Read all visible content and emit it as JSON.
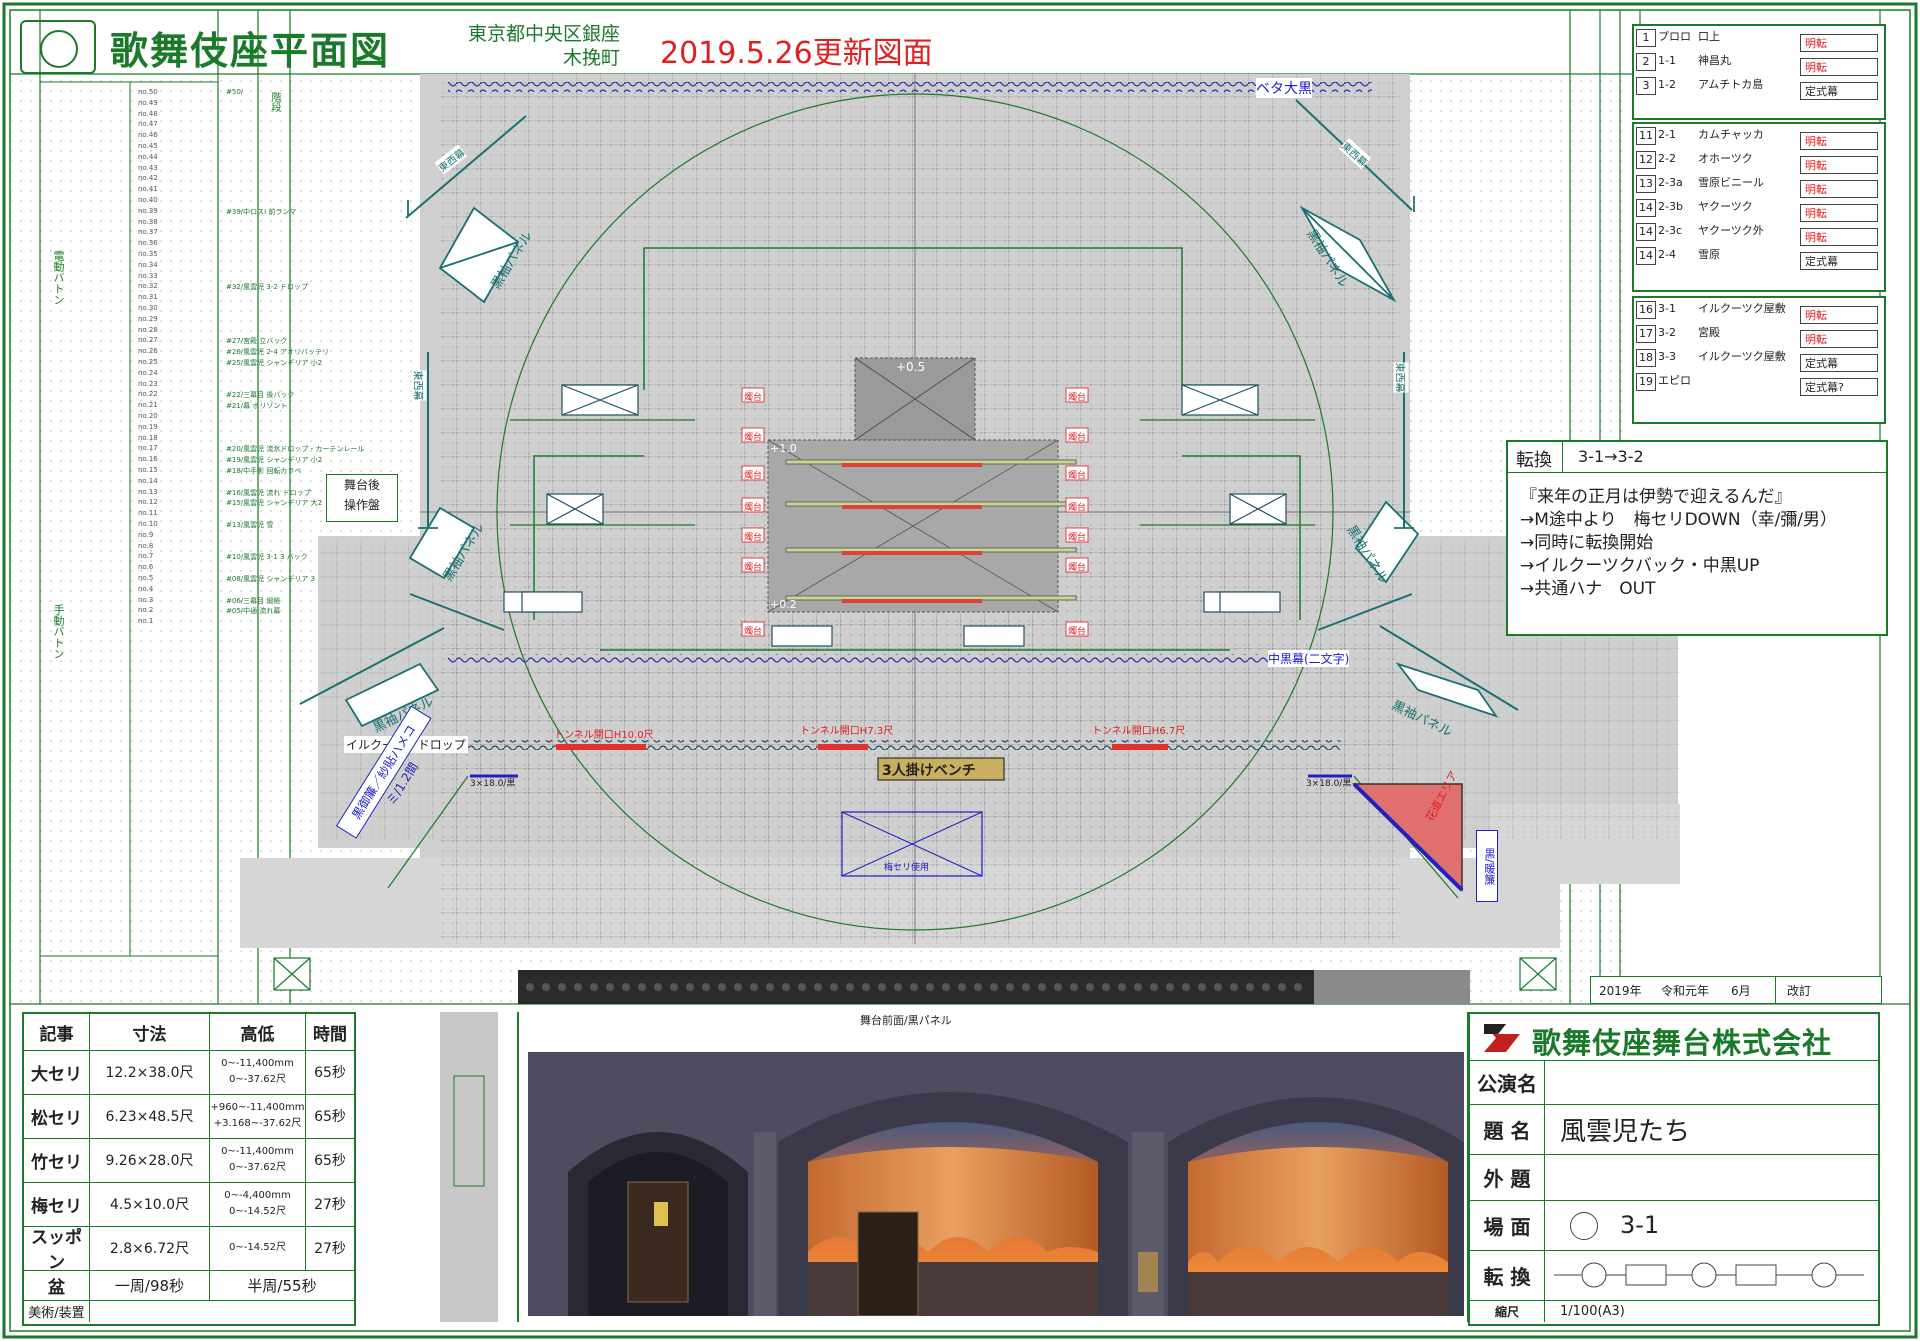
{
  "header": {
    "title": "歌舞伎座平面図",
    "address_line1": "東京都中央区銀座",
    "address_line2": "木挽町",
    "date_note": "2019.5.26更新図面"
  },
  "scenes_group1": [
    {
      "no": "1",
      "scene": "プロロ",
      "title": "口上",
      "change": "明転"
    },
    {
      "no": "2",
      "scene": "1-1",
      "title": "神昌丸",
      "change": "明転"
    },
    {
      "no": "3",
      "scene": "1-2",
      "title": "アムチトカ島",
      "change": "定式幕"
    }
  ],
  "scenes_group2": [
    {
      "no": "11",
      "scene": "2-1",
      "title": "カムチャッカ",
      "change": "明転"
    },
    {
      "no": "12",
      "scene": "2-2",
      "title": "オホーツク",
      "change": "明転"
    },
    {
      "no": "13",
      "scene": "2-3a",
      "title": "雪原ビニール",
      "change": "明転"
    },
    {
      "no": "14",
      "scene": "2-3b",
      "title": "ヤクーツク",
      "change": "明転"
    },
    {
      "no": "14",
      "scene": "2-3c",
      "title": "ヤクーツク外",
      "change": "明転"
    },
    {
      "no": "14",
      "scene": "2-4",
      "title": "雪原",
      "change": "定式幕"
    }
  ],
  "scenes_group3": [
    {
      "no": "16",
      "scene": "3-1",
      "title": "イルクーツク屋敷",
      "change": "明転"
    },
    {
      "no": "17",
      "scene": "3-2",
      "title": "宮殿",
      "change": "明転"
    },
    {
      "no": "18",
      "scene": "3-3",
      "title": "イルクーツク屋敷",
      "change": "定式幕"
    },
    {
      "no": "19",
      "scene": "エピロ",
      "title": "",
      "change": "定式幕?"
    }
  ],
  "transition": {
    "label": "転換",
    "value": "3-1→3-2",
    "lines": [
      "『来年の正月は伊勢で迎えるんだ』",
      "→M途中より　梅セリDOWN（幸/彌/男）",
      "→同時に転換開始",
      "→イルクーツクバック・中黒UP",
      "→共通ハナ　OUT"
    ]
  },
  "stage_labels": {
    "beta_kuro": "ベタ大黒",
    "naka_kuro": "中黒幕(二文字)",
    "irkutsk_drop": "イルクーツクドロップ",
    "bench": "3人掛けベンチ",
    "ume_seri": "梅セリ使用",
    "tunnel1": "トンネル開口H10.0尺",
    "tunnel2": "トンネル開口H7.3尺",
    "tunnel3": "トンネル開口H6.7尺",
    "kurosode_panel": "黒袖パネル",
    "touzai_maku": "東西幕",
    "candle": "燭台",
    "butai_ura": "舞台後",
    "sousa_ban": "操作盤",
    "plus05": "+0.5",
    "plus10": "+1.0",
    "plus02": "+0.2",
    "left_sign": "黒御簾／紗貼ハメコミ/1.2間",
    "right_sign": "花道エリア",
    "right_vert": "黒/暖簾",
    "left_3x18": "3×18.0/黒",
    "right_3x18": "3×18.0/黒",
    "electric_batten": "電動バトン",
    "manual_batten": "手動バトン",
    "kaidan": "階段",
    "front_label": "舞台前面/黒パネル"
  },
  "revision": {
    "year": "2019年",
    "era": "令和元年",
    "month": "6月",
    "label": "改訂"
  },
  "seri_table": {
    "headers": [
      "記事",
      "寸法",
      "高低",
      "時間"
    ],
    "rows": [
      {
        "name": "大セリ",
        "size": "12.2×38.0尺",
        "range1": "0~-11,400mm",
        "range2": "0~-37.62尺",
        "time": "65秒"
      },
      {
        "name": "松セリ",
        "size": "6.23×48.5尺",
        "range1": "+960~-11,400mm",
        "range2": "+3.168~-37.62尺",
        "time": "65秒"
      },
      {
        "name": "竹セリ",
        "size": "9.26×28.0尺",
        "range1": "0~-11,400mm",
        "range2": "0~-37.62尺",
        "time": "65秒"
      },
      {
        "name": "梅セリ",
        "size": "4.5×10.0尺",
        "range1": "0~-4,400mm",
        "range2": "0~-14.52尺",
        "time": "27秒"
      },
      {
        "name": "スッポン",
        "size": "2.8×6.72尺",
        "range1": "0~-14.52尺",
        "range2": "",
        "time": "27秒"
      }
    ],
    "bon_label": "盆",
    "bon_full": "一周/98秒",
    "bon_half": "半周/55秒",
    "art_label": "美術/装置"
  },
  "title_block": {
    "company": "歌舞伎座舞台株式会社",
    "performance_label": "公演名",
    "performance_value": "",
    "title_label": "題 名",
    "title_value": "風雲児たち",
    "subtitle_label": "外 題",
    "subtitle_value": "",
    "scene_label": "場 面",
    "scene_value": "3-1",
    "change_label": "転 換",
    "scale_label": "縮尺",
    "scale_value": "1/100(A3)"
  },
  "battens": [
    "no.50",
    "no.49",
    "no.48",
    "no.47",
    "no.46",
    "no.45",
    "no.44",
    "no.43",
    "no.42",
    "no.41",
    "no.40",
    "no.39",
    "no.38",
    "no.37",
    "no.36",
    "no.35",
    "no.34",
    "no.33",
    "no.32",
    "no.31",
    "no.30",
    "no.29",
    "no.28",
    "no.27",
    "no.26",
    "no.25",
    "no.24",
    "no.23",
    "no.22",
    "no.21",
    "no.20",
    "no.19",
    "no.18",
    "no.17",
    "no.16",
    "no.15",
    "no.14",
    "no.13",
    "no.12",
    "no.11",
    "no.10",
    "no.9",
    "no.8",
    "no.7",
    "no.6",
    "no.5",
    "no.4",
    "no.3",
    "no.2",
    "no.1"
  ],
  "batten_named": [
    {
      "row": 1,
      "text": "#50/"
    },
    {
      "row": 12,
      "text": "#39/中ロスI 前ランマ"
    },
    {
      "row": 19,
      "text": "#32/風雲児 3-2 ドロップ"
    },
    {
      "row": 24,
      "text": "#27/宮殿 立バック"
    },
    {
      "row": 25,
      "text": "#26/風雲児 2-4 アオリバッテリ"
    },
    {
      "row": 26,
      "text": "#25/風雲児 シャンデリア 小2"
    },
    {
      "row": 29,
      "text": "#22/三幕目 後バック"
    },
    {
      "row": 30,
      "text": "#21/幕 ホリゾント"
    },
    {
      "row": 34,
      "text": "#20/風雲児 流氷ドロップ・カーテンレール"
    },
    {
      "row": 35,
      "text": "#19/風雲児 シャンデリア 小2"
    },
    {
      "row": 36,
      "text": "#18/中手影 回転カラベ"
    },
    {
      "row": 38,
      "text": "#16/風雲児 流れ ドロップ"
    },
    {
      "row": 39,
      "text": "#15/風雲児 シャンデリア 大2"
    },
    {
      "row": 41,
      "text": "#13/風雲児 雪"
    },
    {
      "row": 44,
      "text": "#10/風雲児 3-1 3 バック"
    },
    {
      "row": 46,
      "text": "#08/風雲児 シャンデリア 3"
    },
    {
      "row": 48,
      "text": "#06/三幕目 緞帳"
    },
    {
      "row": 49,
      "text": "#05/中通 流れ幕"
    }
  ]
}
